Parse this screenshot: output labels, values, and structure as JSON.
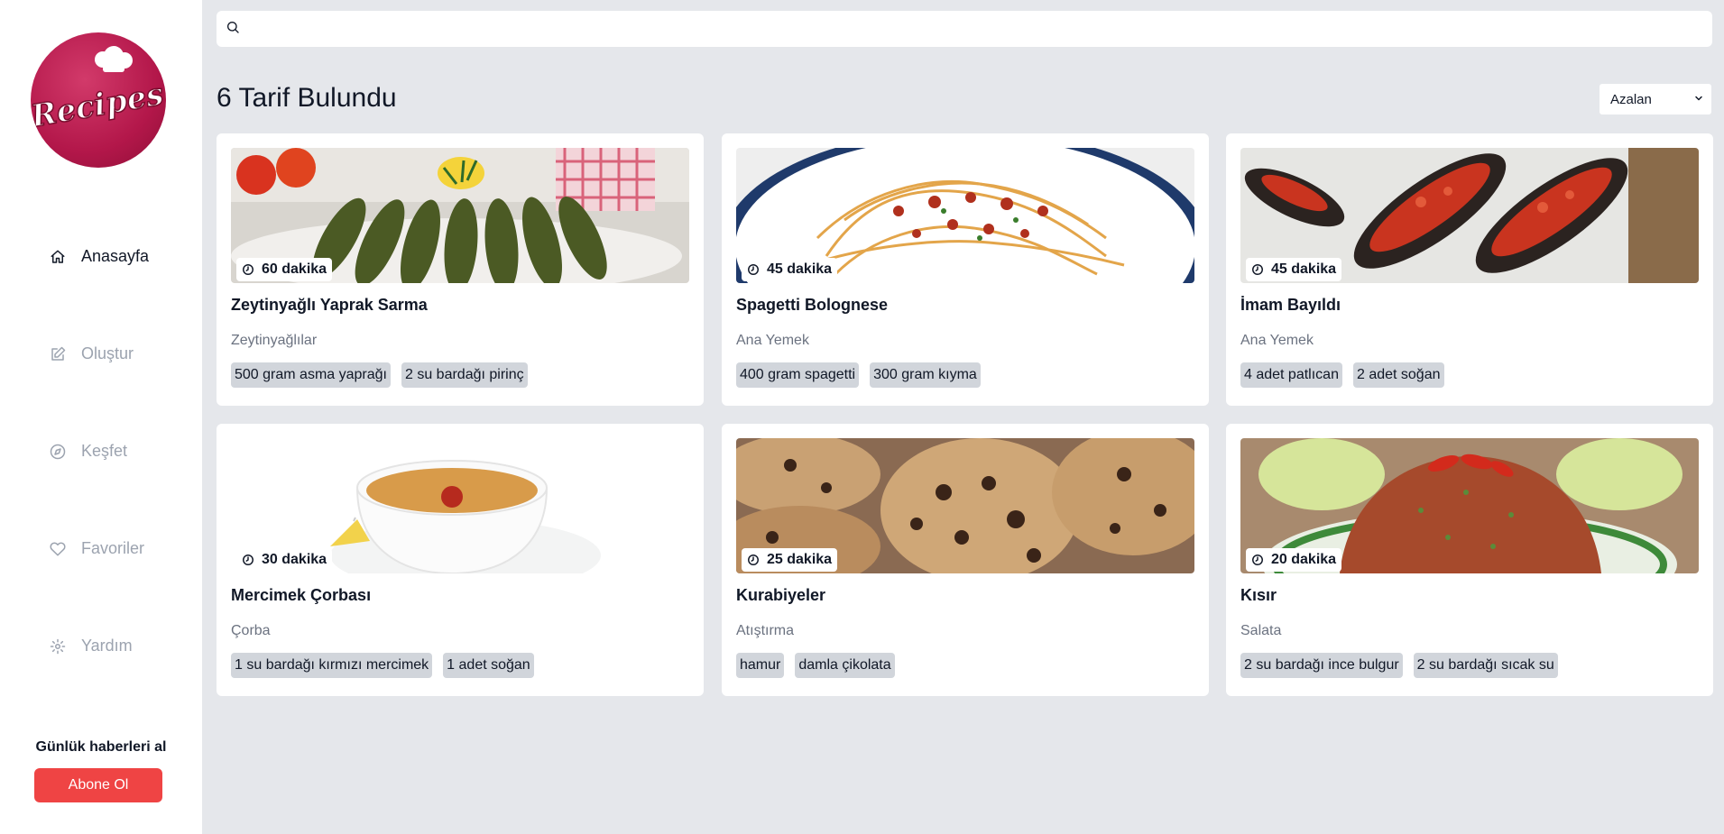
{
  "sidebar": {
    "logo_text": "Recipes",
    "items": [
      {
        "label": "Anasayfa",
        "icon": "home-icon",
        "active": true
      },
      {
        "label": "Oluştur",
        "icon": "edit-icon",
        "active": false
      },
      {
        "label": "Keşfet",
        "icon": "compass-icon",
        "active": false
      },
      {
        "label": "Favoriler",
        "icon": "heart-icon",
        "active": false
      },
      {
        "label": "Yardım",
        "icon": "gear-icon",
        "active": false
      }
    ],
    "newsletter_title": "Günlük haberleri al",
    "subscribe_label": "Abone Ol"
  },
  "search": {
    "placeholder": "",
    "value": ""
  },
  "results": {
    "title": "6 Tarif Bulundu",
    "sort_value": "Azalan"
  },
  "recipes": [
    {
      "time": "60 dakika",
      "title": "Zeytinyağlı Yaprak Sarma",
      "category": "Zeytinyağlılar",
      "tags": [
        "500 gram asma yaprağı",
        "2 su bardağı pirinç"
      ]
    },
    {
      "time": "45 dakika",
      "title": "Spagetti Bolognese",
      "category": "Ana Yemek",
      "tags": [
        "400 gram spagetti",
        "300 gram kıyma"
      ]
    },
    {
      "time": "45 dakika",
      "title": "İmam Bayıldı",
      "category": "Ana Yemek",
      "tags": [
        "4 adet patlıcan",
        "2 adet soğan"
      ]
    },
    {
      "time": "30 dakika",
      "title": "Mercimek Çorbası",
      "category": "Çorba",
      "tags": [
        "1 su bardağı kırmızı mercimek",
        "1 adet soğan"
      ]
    },
    {
      "time": "25 dakika",
      "title": "Kurabiyeler",
      "category": "Atıştırma",
      "tags": [
        "hamur",
        "damla çikolata"
      ]
    },
    {
      "time": "20 dakika",
      "title": "Kısır",
      "category": "Salata",
      "tags": [
        "2 su bardağı ince bulgur",
        "2 su bardağı sıcak su"
      ]
    }
  ],
  "colors": {
    "background": "#e5e7eb",
    "accent": "#ef4444",
    "logo": "#b3174a",
    "tag": "#d1d5db"
  }
}
